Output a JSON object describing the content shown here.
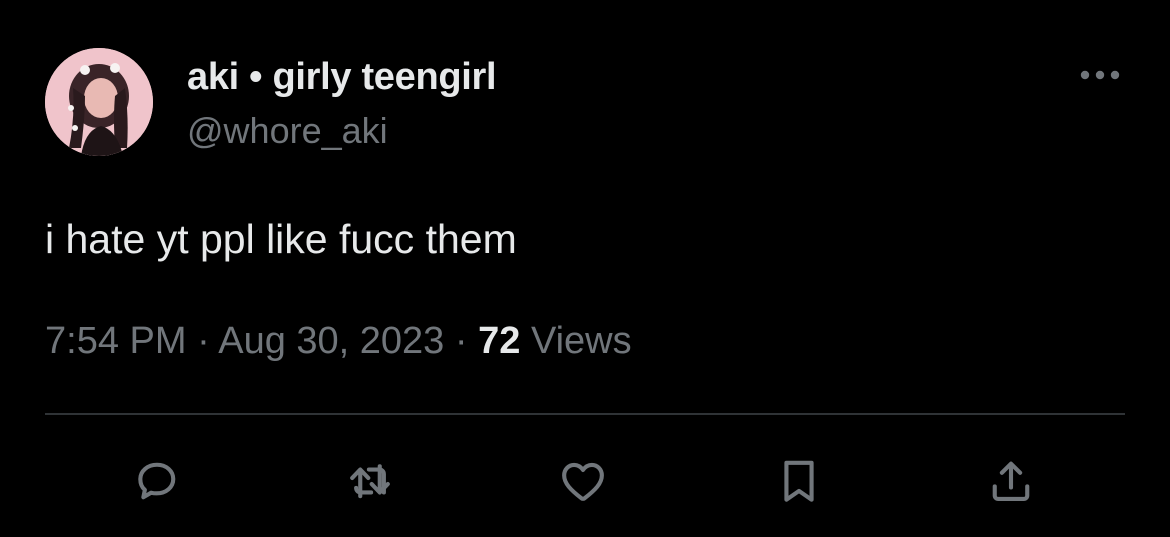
{
  "tweet": {
    "author": {
      "display_name": "aki • girly teengirl",
      "handle": "@whore_aki"
    },
    "text": "i hate yt ppl like fucc them",
    "time": "7:54 PM",
    "date": "Aug 30, 2023",
    "separator": "·",
    "views_count": "72",
    "views_label": "Views"
  },
  "actions": [
    {
      "icon": "reply-icon"
    },
    {
      "icon": "retweet-icon"
    },
    {
      "icon": "like-icon"
    },
    {
      "icon": "bookmark-icon"
    },
    {
      "icon": "share-icon"
    }
  ],
  "colors": {
    "background": "#000000",
    "primary_text": "#e7e9ea",
    "secondary_text": "#71767b",
    "divider": "#2f3336",
    "avatar_bg": "#f2c9cf"
  }
}
